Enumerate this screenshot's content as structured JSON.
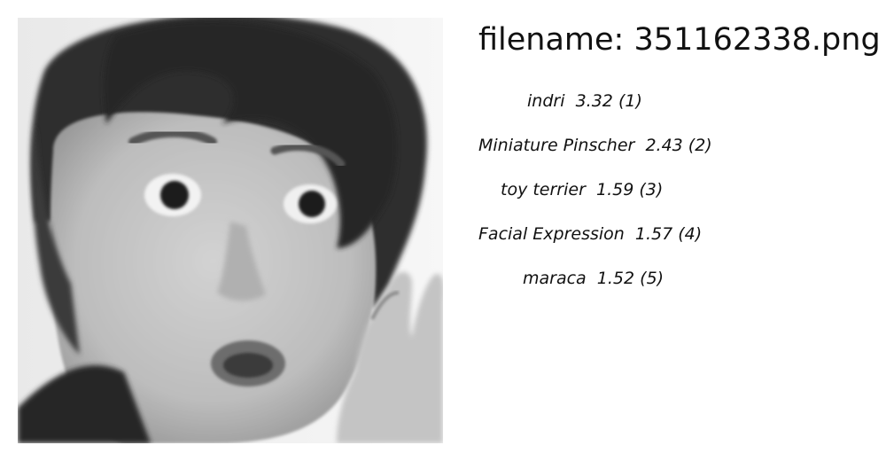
{
  "header": {
    "filename_label": "filename:",
    "filename": "351162338.png"
  },
  "image": {
    "subject": "grayscale close-up of a surprised woman with short dark hair and a raised hand"
  },
  "predictions": [
    {
      "label": "indri",
      "score": "3.32",
      "rank": "(1)"
    },
    {
      "label": "Miniature Pinscher",
      "score": "2.43",
      "rank": "(2)"
    },
    {
      "label": "toy terrier",
      "score": "1.59",
      "rank": "(3)"
    },
    {
      "label": "Facial Expression",
      "score": "1.57",
      "rank": "(4)"
    },
    {
      "label": "maraca",
      "score": "1.52",
      "rank": "(5)"
    }
  ]
}
